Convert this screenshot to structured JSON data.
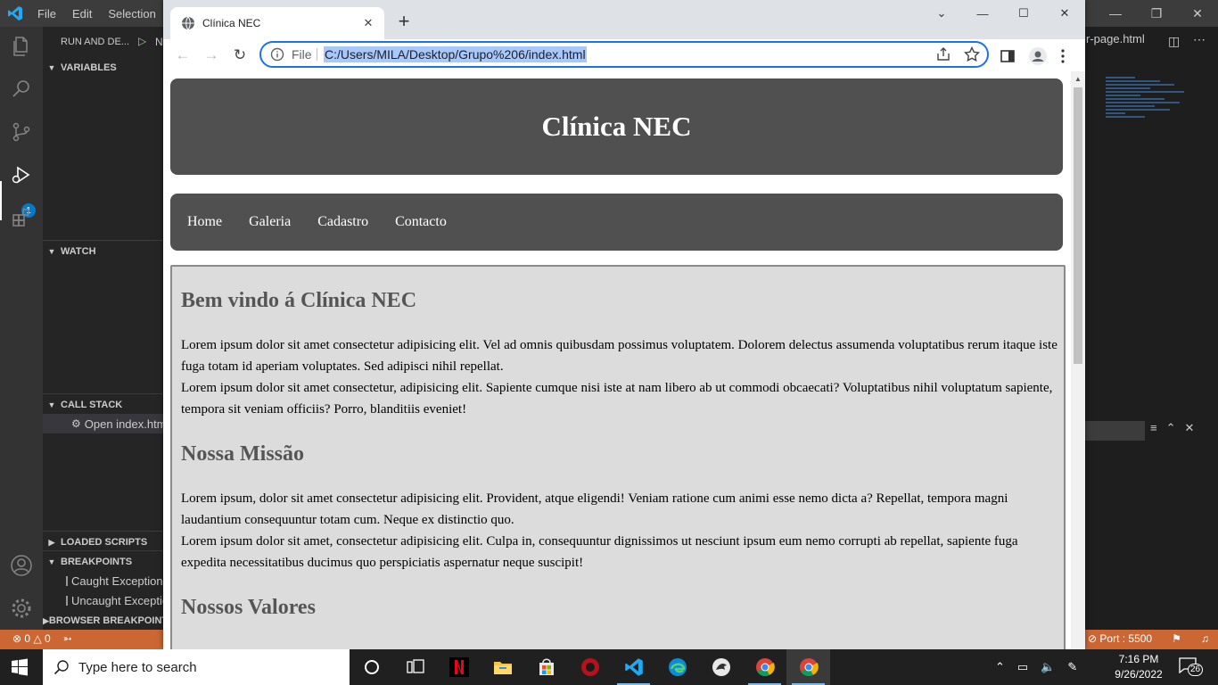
{
  "vscode": {
    "menu": [
      "File",
      "Edit",
      "Selection"
    ],
    "sidebar": {
      "header": "RUN AND DE...",
      "run_config": "N",
      "sections": {
        "variables": "VARIABLES",
        "watch": "WATCH",
        "call_stack": "CALL STACK",
        "loaded_scripts": "LOADED SCRIPTS",
        "breakpoints": "BREAKPOINTS",
        "browser_breakpoints": "BROWSER BREAKPOINTS"
      },
      "call_stack_item": "Open index.html",
      "breakpoint_items": [
        "Caught Exceptions",
        "Uncaught Exceptions"
      ]
    },
    "activity_badge": "1",
    "right_tab": "r-page.html",
    "status": {
      "errors": "0",
      "warnings": "0",
      "port": "Port : 5500"
    }
  },
  "chrome": {
    "tab_title": "Clínica NEC",
    "scheme": "File",
    "url": "C:/Users/MILA/Desktop/Grupo%206/index.html"
  },
  "site": {
    "title": "Clínica NEC",
    "nav": [
      "Home",
      "Galeria",
      "Cadastro",
      "Contacto"
    ],
    "sections": [
      {
        "heading": "Bem vindo á Clínica NEC",
        "paragraphs": [
          "Lorem ipsum dolor sit amet consectetur adipisicing elit. Vel ad omnis quibusdam possimus voluptatem. Dolorem delectus assumenda voluptatibus rerum itaque iste fuga totam id aperiam voluptates. Sed adipisci nihil repellat.",
          "Lorem ipsum dolor sit amet consectetur, adipisicing elit. Sapiente cumque nisi iste at nam libero ab ut commodi obcaecati? Voluptatibus nihil voluptatum sapiente, tempora sit veniam officiis? Porro, blanditiis eveniet!"
        ]
      },
      {
        "heading": "Nossa Missão",
        "paragraphs": [
          "Lorem ipsum, dolor sit amet consectetur adipisicing elit. Provident, atque eligendi! Veniam ratione cum animi esse nemo dicta a? Repellat, tempora magni laudantium consequuntur totam cum. Neque ex distinctio quo.",
          "Lorem ipsum dolor sit amet, consectetur adipisicing elit. Culpa in, consequuntur dignissimos ut nesciunt ipsum eum nemo corrupti ab repellat, sapiente fuga expedita necessitatibus ducimus quo perspiciatis aspernatur neque suscipit!"
        ]
      },
      {
        "heading": "Nossos Valores",
        "paragraphs": []
      }
    ]
  },
  "taskbar": {
    "search_placeholder": "Type here to search",
    "time": "7:16 PM",
    "date": "9/26/2022",
    "notification_count": "26"
  },
  "colors": {
    "vscode_status": "#cc6633",
    "omnibox_focus": "#1a73e8",
    "site_header_bg": "#505050",
    "site_main_bg": "#dcdcdc"
  }
}
